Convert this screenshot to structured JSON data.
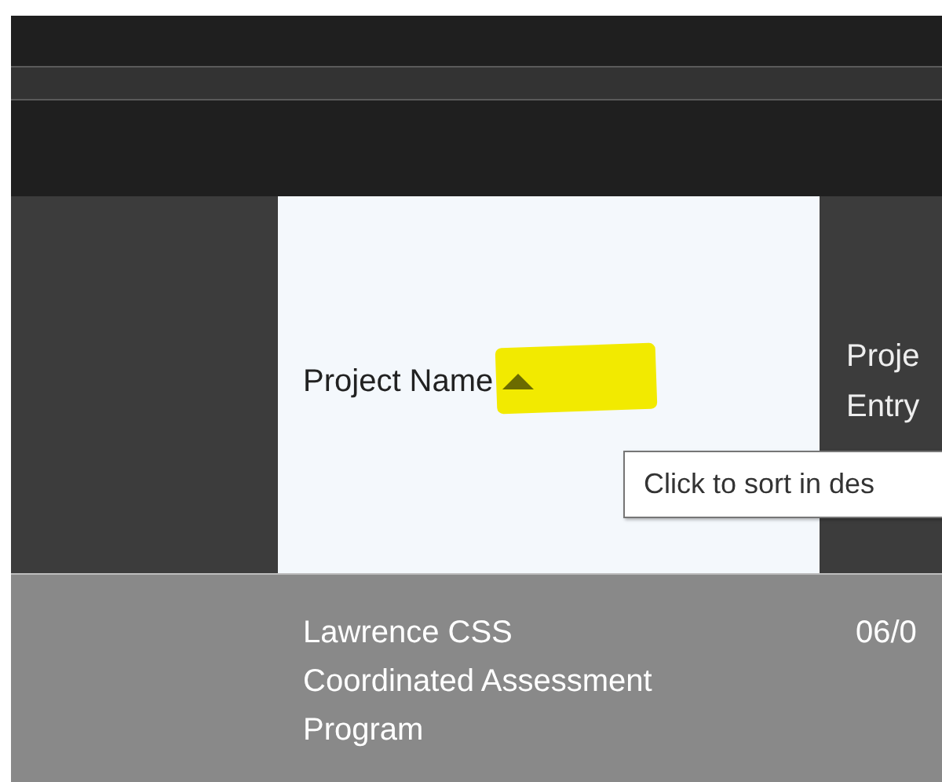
{
  "table": {
    "columns": [
      {
        "lines": [
          "Project Name"
        ],
        "selected": true,
        "sorted_ascending": true
      },
      {
        "lines": [
          "Proje",
          "Entry"
        ],
        "selected": false,
        "sorted_ascending": false
      }
    ],
    "rows": [
      {
        "cells": [
          [
            "Lawrence CSS",
            "Coordinated Assessment",
            "Program"
          ],
          [
            "06/0"
          ]
        ]
      }
    ]
  },
  "tooltip": {
    "text": "Click to sort in des"
  }
}
